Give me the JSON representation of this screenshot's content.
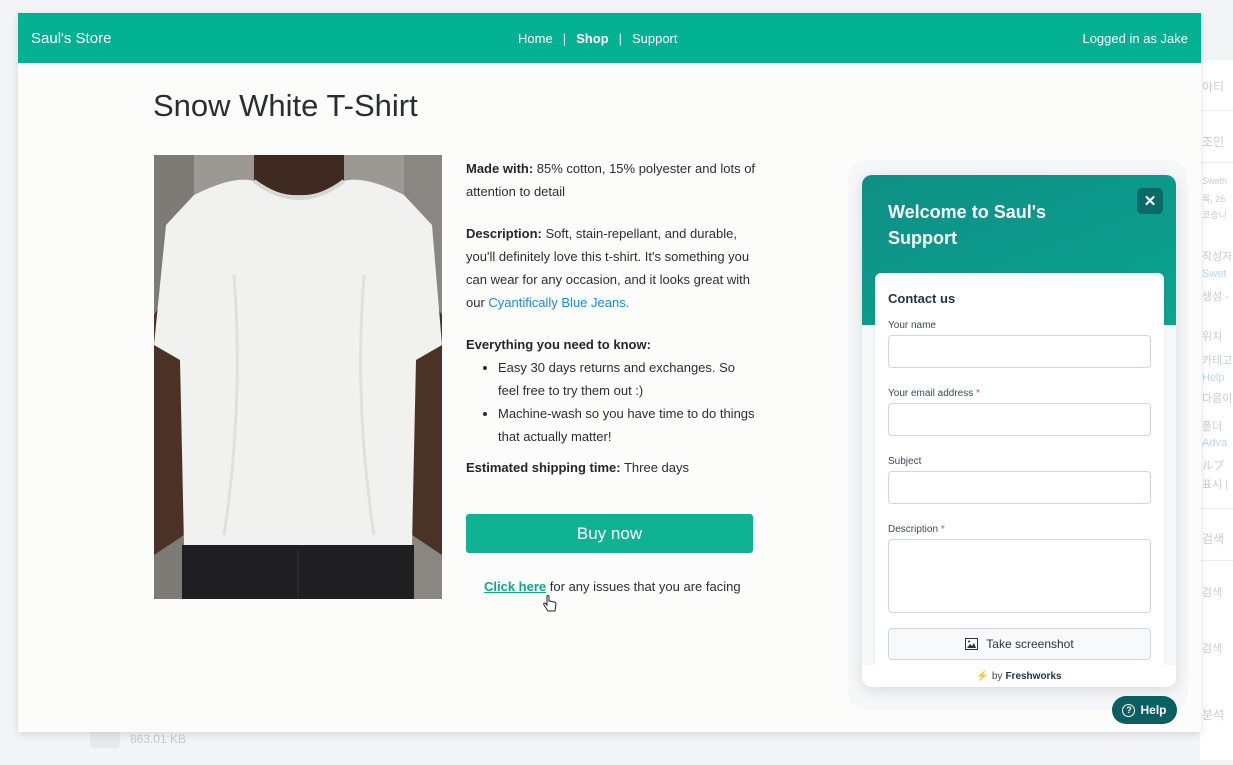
{
  "navbar": {
    "brand": "Saul's Store",
    "links": [
      "Home",
      "Shop",
      "Support"
    ],
    "separator": "|",
    "user_status": "Logged in as Jake",
    "accent": "#02b192"
  },
  "product": {
    "title": "Snow White T-Shirt",
    "made_with_label": "Made with:",
    "made_with": "85% cotton, 15% polyester and lots of attention to detail",
    "description_label": "Description:",
    "description": "Soft, stain-repellant, and durable, you'll definitely love this t-shirt. It's something you can wear for any occasion, and it looks great with our",
    "description_link": "Cyantifically Blue Jeans.",
    "know_heading": "Everything you need to know:",
    "know_items": [
      "Easy 30 days returns and exchanges. So feel free to try them out :)",
      "Machine-wash so you have time to do things that actually matter!"
    ],
    "shipping_label": "Estimated shipping time:",
    "shipping": "Three days",
    "buy_label": "Buy now",
    "issue_link": "Click here",
    "issue_text": "for any issues that you are facing"
  },
  "widget": {
    "title": "Welcome to Saul's Support",
    "close_icon": "close-icon",
    "form_heading": "Contact us",
    "fields": [
      {
        "label": "Your name",
        "required": false
      },
      {
        "label": "Your email address",
        "required": true
      },
      {
        "label": "Subject",
        "required": false
      },
      {
        "label": "Description",
        "required": true
      }
    ],
    "required_mark": "*",
    "screenshot_label": "Take screenshot",
    "footer_prefix": "by",
    "footer_brand": "Freshworks",
    "help_label": "Help"
  },
  "background": {
    "side_texts": [
      "아티",
      "조인",
      "Sweth",
      "록, 26",
      "코승니",
      "작성자",
      "Swet",
      "생성 -",
      "위치",
      "카테고",
      "Help",
      "다음이",
      "폴더",
      "Adva",
      "ルプ",
      "표시 |",
      "검색",
      "검색 ",
      "검색 ",
      "분석"
    ],
    "bottom_size": "863.01 KB"
  }
}
